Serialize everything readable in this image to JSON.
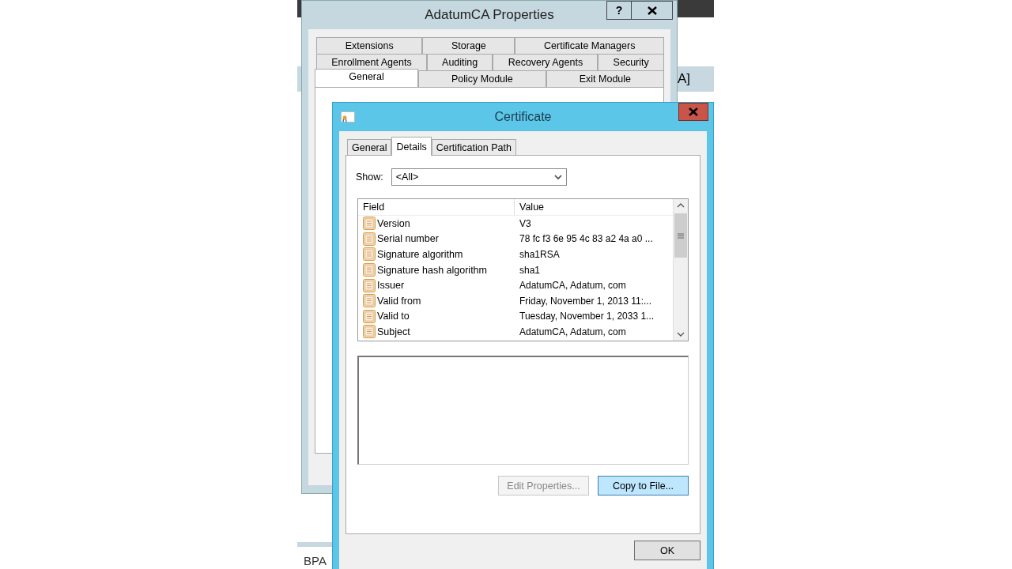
{
  "background_app": {
    "header_text": "A]",
    "footer_text": "BPA"
  },
  "properties_window": {
    "title": "AdatumCA Properties",
    "help_button": "?",
    "tab_rows": [
      [
        {
          "label": "Extensions",
          "selected": false
        },
        {
          "label": "Storage",
          "selected": false
        },
        {
          "label": "Certificate Managers",
          "selected": false
        }
      ],
      [
        {
          "label": "Enrollment Agents",
          "selected": false
        },
        {
          "label": "Auditing",
          "selected": false
        },
        {
          "label": "Recovery Agents",
          "selected": false
        },
        {
          "label": "Security",
          "selected": false
        }
      ],
      [
        {
          "label": "General",
          "selected": true
        },
        {
          "label": "Policy Module",
          "selected": false
        },
        {
          "label": "Exit Module",
          "selected": false
        }
      ]
    ]
  },
  "certificate_window": {
    "title": "Certificate",
    "tabs": [
      {
        "label": "General",
        "selected": false
      },
      {
        "label": "Details",
        "selected": true
      },
      {
        "label": "Certification Path",
        "selected": false
      }
    ],
    "show": {
      "label": "Show:",
      "value": "<All>"
    },
    "table": {
      "columns": [
        "Field",
        "Value"
      ],
      "rows": [
        {
          "field": "Version",
          "value": "V3"
        },
        {
          "field": "Serial number",
          "value": "78 fc f3 6e 95 4c 83 a2 4a a0 ..."
        },
        {
          "field": "Signature algorithm",
          "value": "sha1RSA"
        },
        {
          "field": "Signature hash algorithm",
          "value": "sha1"
        },
        {
          "field": "Issuer",
          "value": "AdatumCA, Adatum, com"
        },
        {
          "field": "Valid from",
          "value": "Friday, November 1, 2013 11:..."
        },
        {
          "field": "Valid to",
          "value": "Tuesday, November 1, 2033 1..."
        },
        {
          "field": "Subject",
          "value": "AdatumCA, Adatum, com"
        }
      ]
    },
    "buttons": [
      {
        "label": "Edit Properties...",
        "disabled": true,
        "default": false
      },
      {
        "label": "Copy to File...",
        "disabled": false,
        "default": true
      }
    ],
    "ok_button": "OK"
  }
}
